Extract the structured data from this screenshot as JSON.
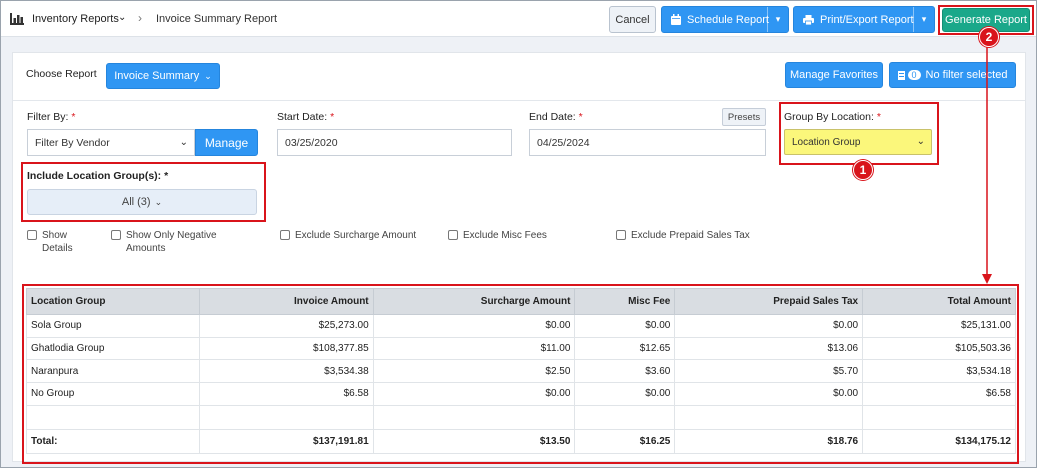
{
  "breadcrumb": {
    "parent": "Inventory Reports",
    "current": "Invoice Summary Report"
  },
  "toolbar": {
    "cancel_label": "Cancel",
    "schedule_label": "Schedule Report",
    "print_label": "Print/Export Report",
    "generate_label": "Generate Report"
  },
  "report": {
    "choose_label": "Choose Report",
    "selected": "Invoice Summary",
    "manage_favorites_label": "Manage Favorites",
    "filter_count": "0",
    "filter_status": "No filter selected"
  },
  "filters": {
    "filter_by_label": "Filter By:",
    "filter_by_value": "Filter By Vendor",
    "manage_label": "Manage",
    "start_date_label": "Start Date:",
    "start_date_value": "03/25/2020",
    "end_date_label": "End Date:",
    "end_date_value": "04/25/2024",
    "presets_label": "Presets",
    "group_by_label": "Group By Location:",
    "group_by_value": "Location Group",
    "include_groups_label": "Include Location Group(s):",
    "include_groups_value": "All (3)",
    "required_mark": "*"
  },
  "checkboxes": [
    {
      "label": "Show Details",
      "checked": false
    },
    {
      "label": "Show Only Negative Amounts",
      "checked": false
    },
    {
      "label": "Exclude Surcharge Amount",
      "checked": false
    },
    {
      "label": "Exclude Misc Fees",
      "checked": false
    },
    {
      "label": "Exclude Prepaid Sales Tax",
      "checked": false
    }
  ],
  "annotations": {
    "badge1": "1",
    "badge2": "2"
  },
  "table": {
    "headers": [
      "Location Group",
      "Invoice Amount",
      "Surcharge Amount",
      "Misc Fee",
      "Prepaid Sales Tax",
      "Total Amount"
    ],
    "rows": [
      [
        "Sola Group",
        "$25,273.00",
        "$0.00",
        "$0.00",
        "$0.00",
        "$25,131.00"
      ],
      [
        "Ghatlodia Group",
        "$108,377.85",
        "$11.00",
        "$12.65",
        "$13.06",
        "$105,503.36"
      ],
      [
        "Naranpura",
        "$3,534.38",
        "$2.50",
        "$3.60",
        "$5.70",
        "$3,534.18"
      ],
      [
        "No Group",
        "$6.58",
        "$0.00",
        "$0.00",
        "$0.00",
        "$6.58"
      ]
    ],
    "total": [
      "Total:",
      "$137,191.81",
      "$13.50",
      "$16.25",
      "$18.76",
      "$134,175.12"
    ]
  },
  "colors": {
    "primary": "#2f96f3",
    "generate": "#1aa88a",
    "highlight": "#fbf77b",
    "annotation": "#d9141b"
  }
}
